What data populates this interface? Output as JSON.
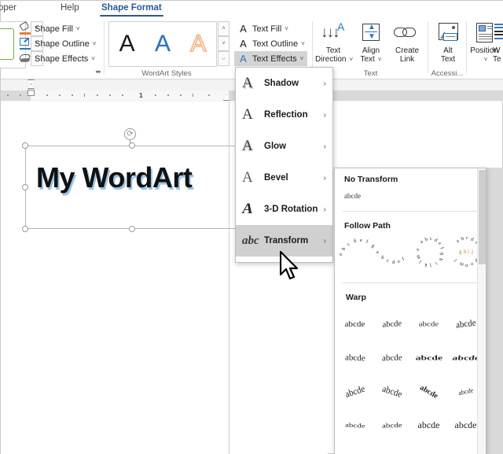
{
  "tabs": [
    {
      "label": "eloper",
      "active": false
    },
    {
      "label": "Help",
      "active": false
    },
    {
      "label": "Shape Format",
      "active": true
    }
  ],
  "ribbon": {
    "shape_commands": [
      {
        "label": "Shape Fill",
        "icon": "paint-bucket-icon",
        "caret": "˅"
      },
      {
        "label": "Shape Outline",
        "icon": "pencil-outline-icon",
        "caret": "˅"
      },
      {
        "label": "Shape Effects",
        "icon": "shape-effects-icon",
        "caret": "˅"
      }
    ],
    "text_commands": [
      {
        "label": "Text Fill",
        "icon": "text-fill-icon",
        "caret": "˅",
        "highlighted": false
      },
      {
        "label": "Text Outline",
        "icon": "text-outline-icon",
        "caret": "˅",
        "highlighted": false
      },
      {
        "label": "Text Effects",
        "icon": "text-effects-icon",
        "caret": "˅",
        "highlighted": true
      }
    ],
    "wordart_gallery": {
      "samples": [
        "A",
        "A",
        "A"
      ],
      "scroll_up": "˄",
      "scroll_down": "˅",
      "scroll_more": "⌵"
    },
    "shape_gallery": {
      "scroll_up": "˄",
      "scroll_down": "˅",
      "scroll_more": "⌵"
    },
    "big_buttons": [
      {
        "line1": "Text",
        "line2": "Direction",
        "caret": "˅",
        "icon": "text-direction-icon"
      },
      {
        "line1": "Align",
        "line2": "Text",
        "caret": "˅",
        "icon": "align-text-icon"
      },
      {
        "line1": "Create",
        "line2": "Link",
        "caret": "",
        "icon": "create-link-icon"
      },
      {
        "line1": "Alt",
        "line2": "Text",
        "caret": "",
        "icon": "alt-text-icon"
      },
      {
        "line1": "Position",
        "line2": "",
        "caret": "˅",
        "icon": "position-icon"
      },
      {
        "line1": "W",
        "line2": "Te",
        "caret": "",
        "icon": "wrap-text-icon"
      }
    ],
    "group_labels": {
      "wordart_styles": "WordArt Styles",
      "text": "Text",
      "accessibility": "Accessi...",
      "dialog_launcher": "⬌"
    }
  },
  "ruler": {
    "number_1": "1"
  },
  "document": {
    "wordart_text": "My WordArt",
    "rotate_handle_icon": "⟳"
  },
  "text_effects_menu": {
    "items": [
      {
        "label": "Shadow",
        "icon_letter": "A",
        "icon_style": "shadow",
        "arrow": "›",
        "selected": false
      },
      {
        "label": "Reflection",
        "icon_letter": "A",
        "icon_style": "refl",
        "arrow": "›",
        "selected": false
      },
      {
        "label": "Glow",
        "icon_letter": "A",
        "icon_style": "glow",
        "arrow": "›",
        "selected": false
      },
      {
        "label": "Bevel",
        "icon_letter": "A",
        "icon_style": "bevel",
        "arrow": "›",
        "selected": false
      },
      {
        "label": "3-D Rotation",
        "icon_letter": "A",
        "icon_style": "rot3d",
        "arrow": "›",
        "selected": false
      },
      {
        "label": "Transform",
        "icon_letter": "abc",
        "icon_style": "xform",
        "arrow": "›",
        "selected": true
      }
    ]
  },
  "transform_gallery": {
    "sections": {
      "no_transform_title": "No Transform",
      "no_transform_sample": "abcde",
      "follow_path_title": "Follow Path",
      "warp_title": "Warp"
    },
    "follow_path": [
      {
        "name": "arch-up-curve",
        "chars": "abcdefg"
      },
      {
        "name": "circle",
        "chars": "abcdefghijklm"
      },
      {
        "name": "button",
        "chars": "abcdefg",
        "inner": "ghij"
      }
    ],
    "warp_samples": [
      "abcde",
      "abcde",
      "abcde",
      "abcde",
      "abcde",
      "abcde",
      "abcde",
      "abcde",
      "abcde",
      "abcde",
      "abcde",
      "abcde",
      "abcde",
      "abcde",
      "abcde",
      "abcde"
    ]
  },
  "colors": {
    "accent_blue": "#2b579a",
    "tab_active": "#2b579a",
    "wordart_shadow": "#9dc3e6",
    "highlight_gray": "#d0d0d0",
    "orange": "#ed7d31",
    "green": "#70ad47"
  }
}
